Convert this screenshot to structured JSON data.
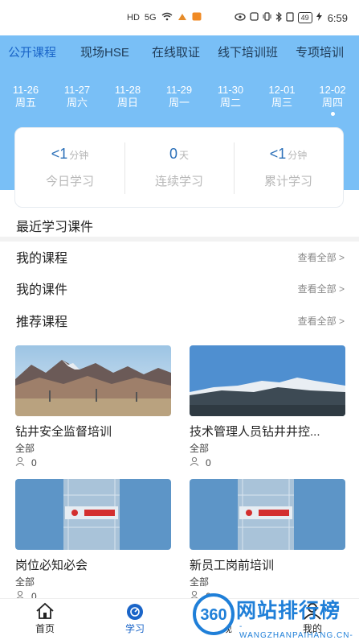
{
  "status_bar": {
    "left_icons": [
      "HD",
      "5G"
    ],
    "battery": "49",
    "time": "6:59"
  },
  "tabs": [
    {
      "label": "公开课程",
      "active": true
    },
    {
      "label": "现场HSE",
      "active": false
    },
    {
      "label": "在线取证",
      "active": false
    },
    {
      "label": "线下培训班",
      "active": false
    },
    {
      "label": "专项培训",
      "active": false
    }
  ],
  "dates": [
    {
      "date": "11-26",
      "weekday": "周五"
    },
    {
      "date": "11-27",
      "weekday": "周六"
    },
    {
      "date": "11-28",
      "weekday": "周日"
    },
    {
      "date": "11-29",
      "weekday": "周一"
    },
    {
      "date": "11-30",
      "weekday": "周二"
    },
    {
      "date": "12-01",
      "weekday": "周三"
    },
    {
      "date": "12-02",
      "weekday": "周四",
      "selected": true
    }
  ],
  "stats": [
    {
      "value": "<1",
      "unit": "分钟",
      "label": "今日学习"
    },
    {
      "value": "0",
      "unit": "天",
      "label": "连续学习"
    },
    {
      "value": "<1",
      "unit": "分钟",
      "label": "累计学习"
    }
  ],
  "recent_title": "最近学习课件",
  "sections": [
    {
      "title": "我的课程",
      "see_all": "查看全部 >"
    },
    {
      "title": "我的课件",
      "see_all": "查看全部 >"
    },
    {
      "title": "推荐课程",
      "see_all": "查看全部 >"
    }
  ],
  "courses": [
    {
      "name": "钻井安全监督培训",
      "category": "全部",
      "learners": "0",
      "image": "mountain-desert"
    },
    {
      "name": "技术管理人员钻井井控...",
      "category": "全部",
      "learners": "0",
      "image": "snow-mountain"
    },
    {
      "name": "岗位必知必会",
      "category": "全部",
      "learners": "0",
      "image": "training-tower"
    },
    {
      "name": "新员工岗前培训",
      "category": "全部",
      "learners": "0",
      "image": "training-tower"
    }
  ],
  "bottom_nav": [
    {
      "label": "首页",
      "icon": "home-icon",
      "active": false
    },
    {
      "label": "学习",
      "icon": "study-icon",
      "active": true
    },
    {
      "label": "发现",
      "icon": "discover-icon",
      "active": false
    },
    {
      "label": "我的",
      "icon": "profile-icon",
      "active": false
    }
  ],
  "watermark": {
    "badge": "360",
    "text": "网站排行榜",
    "sub": "-WANGZHANPAIHANG.CN-"
  },
  "colors": {
    "header_blue": "#79bff6",
    "accent": "#1a65c8"
  }
}
